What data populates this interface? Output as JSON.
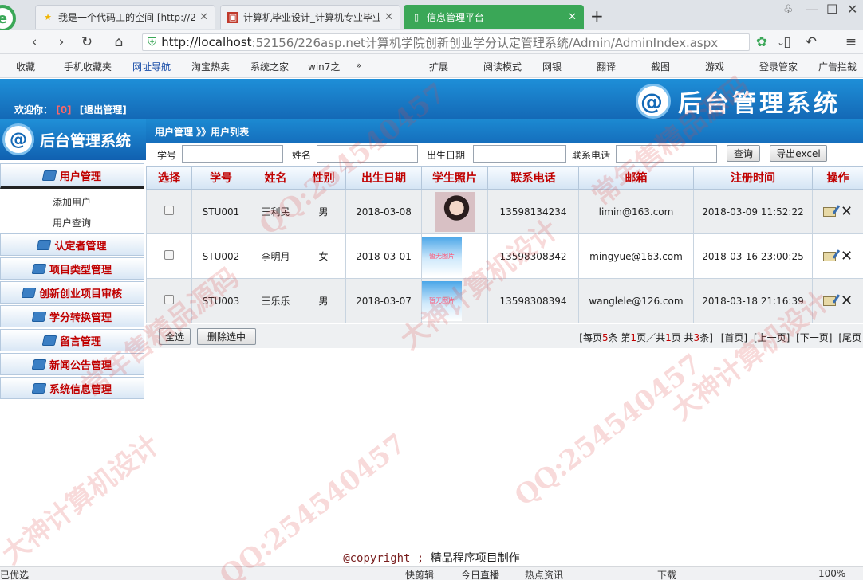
{
  "browser": {
    "tabs": [
      {
        "label": "我是一个代码工的空间 [http://2",
        "active": false
      },
      {
        "label": "计算机毕业设计_计算机专业毕业",
        "active": false
      },
      {
        "label": "信息管理平台",
        "active": true
      }
    ],
    "new_tab": "+",
    "url_host": "http://localhost",
    "url_rest": ":52156/226asp.net计算机学院创新创业学分认定管理系统/Admin/AdminIndex.aspx",
    "bookmarks": [
      "收藏",
      "手机收藏夹",
      "网址导航",
      "淘宝热卖",
      "系统之家",
      "win7之",
      "»",
      "扩展",
      "阅读模式",
      "网银",
      "翻译",
      "截图",
      "游戏",
      "登录管家",
      "广告拦截"
    ]
  },
  "header": {
    "system_title": "后台管理系统",
    "welcome_label": "欢迎你：",
    "user_name": "[0]",
    "logout": "[退出管理]",
    "sidebar_title": "后台管理系统",
    "breadcrumb": "用户管理 》》用户列表"
  },
  "sidebar": {
    "sections": [
      {
        "label": "用户管理",
        "items": [
          "添加用户",
          "用户查询"
        ]
      },
      {
        "label": "认定者管理"
      },
      {
        "label": "项目类型管理"
      },
      {
        "label": "创新创业项目审核"
      },
      {
        "label": "学分转换管理"
      },
      {
        "label": "留言管理"
      },
      {
        "label": "新闻公告管理"
      },
      {
        "label": "系统信息管理"
      }
    ]
  },
  "search": {
    "fields": [
      "学号",
      "姓名",
      "出生日期",
      "联系电话"
    ],
    "query_button": "查询",
    "export_button": "导出excel"
  },
  "table": {
    "headers": [
      "选择",
      "学号",
      "姓名",
      "性别",
      "出生日期",
      "学生照片",
      "联系电话",
      "邮箱",
      "注册时间",
      "操作"
    ],
    "no_photo_text": "暂无图片",
    "rows": [
      {
        "id": "STU001",
        "name": "王利民",
        "gender": "男",
        "birth": "2018-03-08",
        "photo": "girl",
        "phone": "13598134234",
        "email": "limin@163.com",
        "registered": "2018-03-09 11:52:22"
      },
      {
        "id": "STU002",
        "name": "李明月",
        "gender": "女",
        "birth": "2018-03-01",
        "photo": "none",
        "phone": "13598308342",
        "email": "mingyue@163.com",
        "registered": "2018-03-16 23:00:25"
      },
      {
        "id": "STU003",
        "name": "王乐乐",
        "gender": "男",
        "birth": "2018-03-07",
        "photo": "none",
        "phone": "13598308394",
        "email": "wanglele@126.com",
        "registered": "2018-03-18 21:16:39"
      }
    ]
  },
  "actions": {
    "select_all": "全选",
    "delete_selected": "删除选中"
  },
  "pager": {
    "p1": "[每页",
    "per_page": "5",
    "p2": "条 第",
    "current": "1",
    "p3": "页／共",
    "pages": "1",
    "p4": "页 共",
    "total": "3",
    "p5": "条]",
    "first": "[首页]",
    "prev": "[上一页]",
    "next": "[下一页]",
    "last": "[尾页"
  },
  "footer": {
    "copyright": "@copyright ;",
    "text": "精品程序项目制作"
  },
  "statusbar": [
    "已优选",
    "快剪辑",
    "今日直播",
    "热点资讯",
    "下载",
    "100%"
  ],
  "watermark": [
    "常年售精品源码",
    "QQ:254540457",
    "大神计算机设计"
  ],
  "colors": {
    "header_blue": "#1469b6",
    "active_tab": "#3aa757",
    "menu_red": "#c00000"
  }
}
